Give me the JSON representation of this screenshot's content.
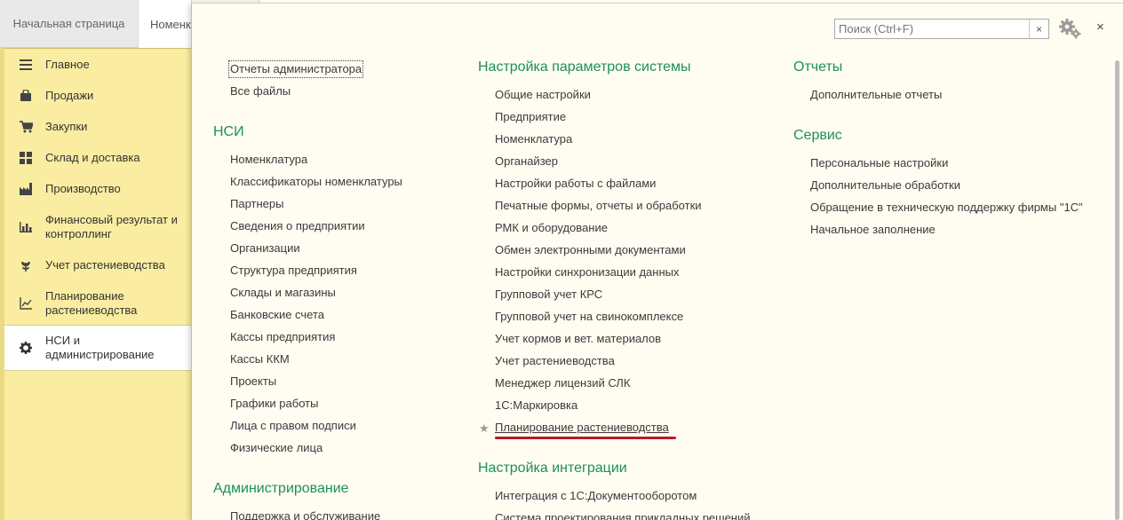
{
  "tabs": [
    {
      "label": "Начальная страница"
    },
    {
      "label": "Номенклатура"
    },
    {
      "label": ""
    }
  ],
  "sidebar": {
    "items": [
      {
        "label": "Главное",
        "icon": "menu-lines-icon"
      },
      {
        "label": "Продажи",
        "icon": "shopping-bag-icon"
      },
      {
        "label": "Закупки",
        "icon": "cart-icon"
      },
      {
        "label": "Склад и доставка",
        "icon": "grid-icon"
      },
      {
        "label": "Производство",
        "icon": "factory-icon"
      },
      {
        "label": "Финансовый результат и контроллинг",
        "icon": "bar-chart-icon"
      },
      {
        "label": "Учет растениеводства",
        "icon": "plant-icon"
      },
      {
        "label": "Планирование растениеводства",
        "icon": "line-chart-icon"
      },
      {
        "label": "НСИ и администрирование",
        "icon": "gear-icon",
        "active": true
      }
    ]
  },
  "search": {
    "placeholder": "Поиск (Ctrl+F)",
    "clear": "×"
  },
  "close_label": "×",
  "col1": {
    "top_links": [
      "Отчеты администратора",
      "Все файлы"
    ],
    "nsi": {
      "title": "НСИ",
      "links": [
        "Номенклатура",
        "Классификаторы номенклатуры",
        "Партнеры",
        "Сведения о предприятии",
        "Организации",
        "Структура предприятия",
        "Склады и магазины",
        "Банковские счета",
        "Кассы предприятия",
        "Кассы ККМ",
        "Проекты",
        "Графики работы",
        "Лица с правом подписи",
        "Физические лица"
      ]
    },
    "admin": {
      "title": "Администрирование",
      "links": [
        "Поддержка и обслуживание"
      ]
    }
  },
  "col2": {
    "params": {
      "title": "Настройка параметров системы",
      "links": [
        "Общие настройки",
        "Предприятие",
        "Номенклатура",
        "Органайзер",
        "Настройки работы с файлами",
        "Печатные формы, отчеты и обработки",
        "РМК и оборудование",
        "Обмен электронными документами",
        "Настройки синхронизации данных",
        "Групповой учет КРС",
        "Групповой учет на свинокомплексе",
        "Учет кормов и вет. материалов",
        "Учет растениеводства",
        "Менеджер лицензий СЛК",
        "1С:Маркировка",
        "Планирование растениеводства"
      ]
    },
    "integration": {
      "title": "Настройка интеграции",
      "links": [
        "Интеграция с 1С:Документооборотом",
        "Система проектирования прикладных решений"
      ]
    }
  },
  "col3": {
    "reports": {
      "title": "Отчеты",
      "links": [
        "Дополнительные отчеты"
      ]
    },
    "service": {
      "title": "Сервис",
      "links": [
        "Персональные настройки",
        "Дополнительные обработки",
        "Обращение в техническую поддержку фирмы \"1С\"",
        "Начальное заполнение"
      ]
    }
  },
  "star_glyph": "★",
  "colors": {
    "section": "#1f8f5a",
    "sidebar": "#faeda1",
    "panel": "#fffdf2",
    "highlight": "#b81a2c"
  }
}
